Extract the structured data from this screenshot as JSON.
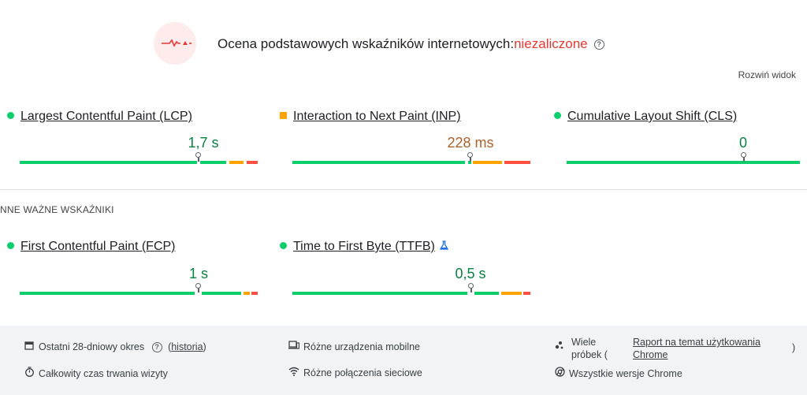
{
  "assessment": {
    "title": "Ocena podstawowych wskaźników internetowych:",
    "result": "niezaliczone",
    "help": "?"
  },
  "expand_label": "Rozwiń widok",
  "core_metrics": [
    {
      "name": "Largest Contentful Paint (LCP)",
      "value": "1,7 s",
      "status": "good",
      "distribution": [
        75,
        12,
        8,
        5
      ]
    },
    {
      "name": "Interaction to Next Paint (INP)",
      "value": "228 ms",
      "status": "needs-improvement",
      "distribution": [
        73,
        14,
        2,
        11
      ]
    },
    {
      "name": "Cumulative Layout Shift (CLS)",
      "value": "0",
      "status": "good",
      "distribution": [
        100,
        0,
        0,
        0
      ]
    }
  ],
  "other_section_title": "NNE WAŻNE WSKAŹNIKI",
  "other_metrics": [
    {
      "name": "First Contentful Paint (FCP)",
      "value": "1 s",
      "status": "good",
      "distribution": [
        88,
        4,
        4,
        4
      ],
      "experimental": false
    },
    {
      "name": "Time to First Byte (TTFB)",
      "value": "0,5 s",
      "status": "good",
      "distribution": [
        75,
        10,
        11,
        4
      ],
      "experimental": true
    }
  ],
  "footer": {
    "period": "Ostatni 28-dniowy okres",
    "period_help": "?",
    "history_link": "historia",
    "visit": "Całkowity czas trwania wizyty",
    "devices": "Różne urządzenia mobilne",
    "network": "Różne połączenia sieciowe",
    "samples_line1": "Wiele",
    "samples_line2": "próbek (",
    "report_link1": "Raport na temat użytkowania",
    "report_link2": "Chrome",
    "report_close": ")",
    "versions": "Wszystkie wersje Chrome"
  },
  "colors": {
    "good": "#0cce6b",
    "average": "#ffa400",
    "poor": "#ff4e42",
    "fail_text": "#e53935"
  },
  "icons": [
    "pulse-icon",
    "help-icon",
    "calendar-icon",
    "stopwatch-icon",
    "devices-icon",
    "wifi-icon",
    "samples-icon",
    "chrome-icon",
    "beaker-icon"
  ]
}
